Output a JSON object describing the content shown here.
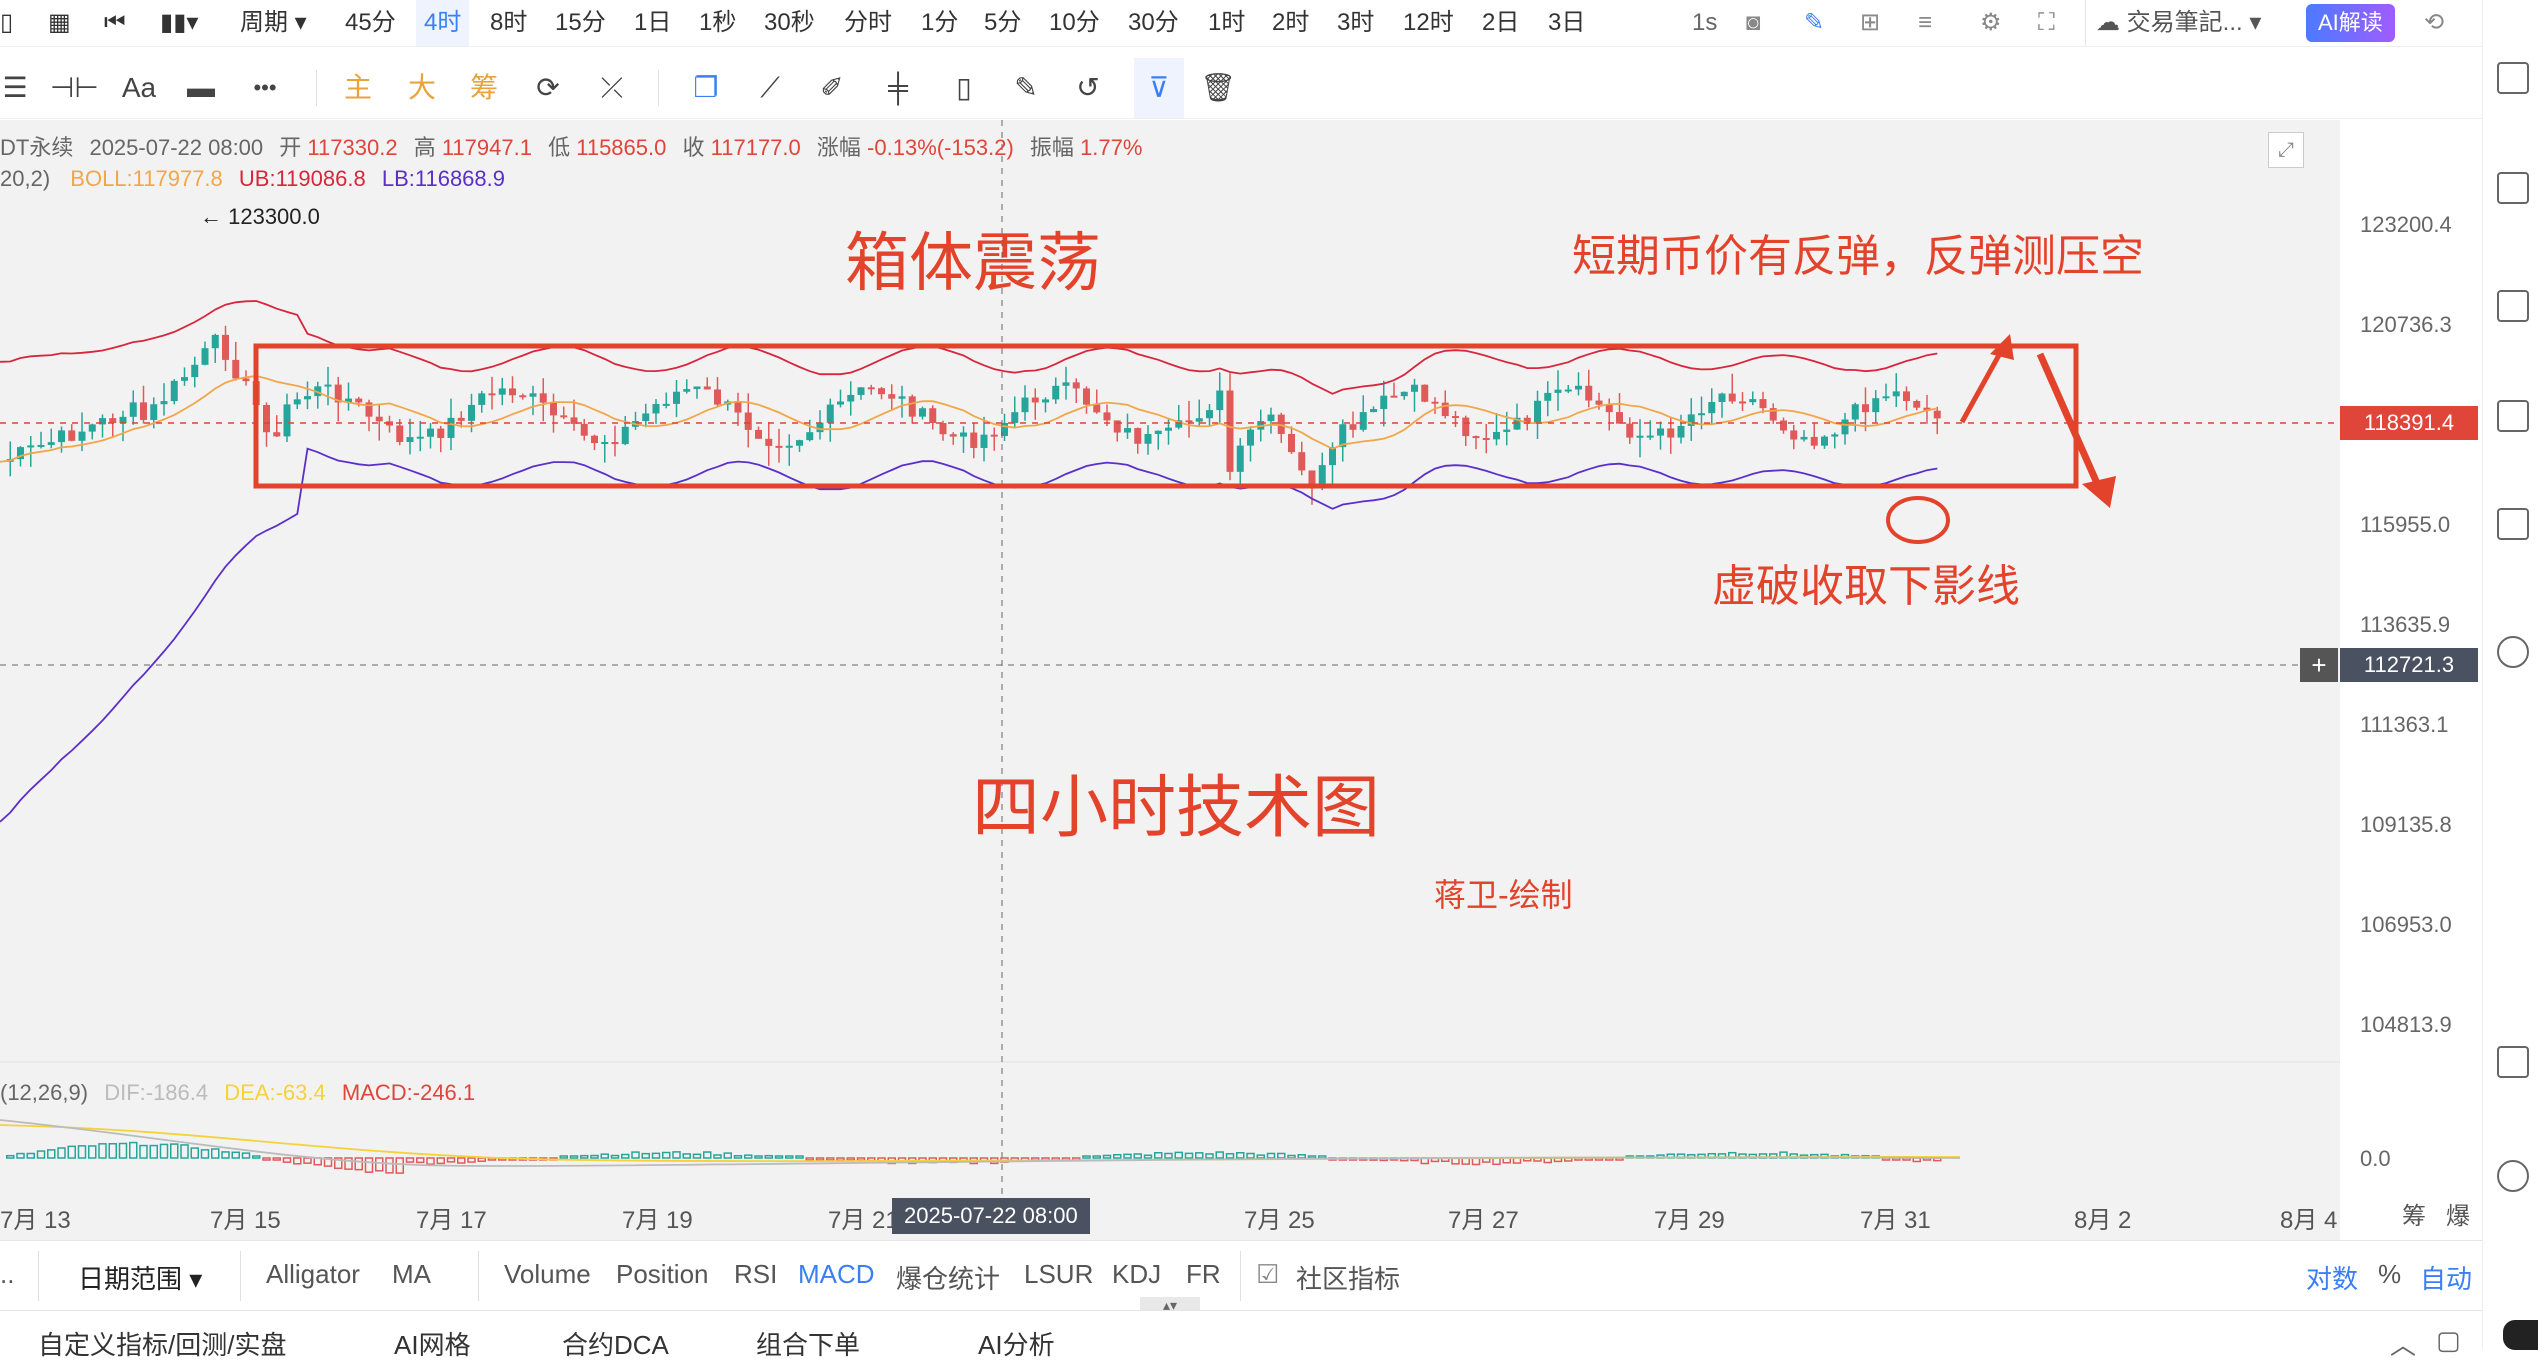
{
  "toolbar": {
    "timeframes": [
      "周期",
      "45分",
      "4时",
      "8时",
      "15分",
      "1日",
      "1秒",
      "30秒",
      "分时",
      "1分",
      "5分",
      "10分",
      "30分",
      "1时",
      "2时",
      "3时",
      "12时",
      "2日",
      "3日"
    ],
    "active_timeframe": "4时",
    "interval_label": "1s",
    "notes_label": "交易筆記...",
    "ai_button": "AI解读"
  },
  "drawing_tools": {
    "font_label": "Aa",
    "more_label": "•••",
    "main_label": "主",
    "big_label": "大",
    "chip_label": "筹"
  },
  "ohlc": {
    "symbol_suffix": "DT永续",
    "datetime": "2025-07-22 08:00",
    "open_label": "开",
    "open": "117330.2",
    "high_label": "高",
    "high": "117947.1",
    "low_label": "低",
    "low": "115865.0",
    "close_label": "收",
    "close": "117177.0",
    "change_label": "涨幅",
    "change": "-0.13%(-153.2)",
    "amp_label": "振幅",
    "amp": "1.77%"
  },
  "boll": {
    "params": "20,2)",
    "boll": "BOLL:117977.8",
    "ub": "UB:119086.8",
    "lb": "LB:116868.9"
  },
  "macd_info": {
    "params": "(12,26,9)",
    "dif": "DIF:-186.4",
    "dea": "DEA:-63.4",
    "macd": "MACD:-246.1"
  },
  "price_axis": {
    "ticks": [
      "123200.4",
      "120736.3",
      "115955.0",
      "113635.9",
      "111363.1",
      "109135.8",
      "106953.0",
      "104813.9"
    ],
    "current_price": "118391.4",
    "crosshair_price": "112721.3",
    "macd_zero": "0.0"
  },
  "x_axis": {
    "ticks": [
      "7月 13",
      "7月 15",
      "7月 17",
      "7月 19",
      "7月 21",
      "7月 25",
      "7月 27",
      "7月 29",
      "7月 31",
      "8月 2",
      "8月 4"
    ],
    "crosshair_time": "2025-07-22 08:00",
    "right_labels": [
      "筹",
      "爆"
    ]
  },
  "annotations": {
    "high_marker": "← 123300.0",
    "box_title": "箱体震荡",
    "note_top": "短期币价有反弹，反弹测压空",
    "note_wick": "虚破收取下影线",
    "chart_title": "四小时技术图",
    "author": "蒋卫-绘制"
  },
  "indicator_tabs": {
    "date_range": "日期范围",
    "items": [
      "Alligator",
      "MA",
      "Volume",
      "Position",
      "RSI",
      "MACD",
      "爆仓统计",
      "LSUR",
      "KDJ",
      "FR"
    ],
    "active": "MACD",
    "community": "社区指标",
    "right": [
      "对数",
      "%",
      "自动"
    ],
    "left_fragment": ".."
  },
  "bottom_bar": {
    "items": [
      "自定义指标/回测/实盘",
      "AI网格",
      "合约DCA",
      "组合下单",
      "AI分析"
    ]
  },
  "colors": {
    "up": "#26a69a",
    "down": "#e05a5a",
    "annotation": "#e3432b",
    "boll_mid": "#f2a64a",
    "boll_upper": "#d7263d",
    "boll_lower": "#5b2fc9",
    "accent": "#3b7ff5"
  }
}
